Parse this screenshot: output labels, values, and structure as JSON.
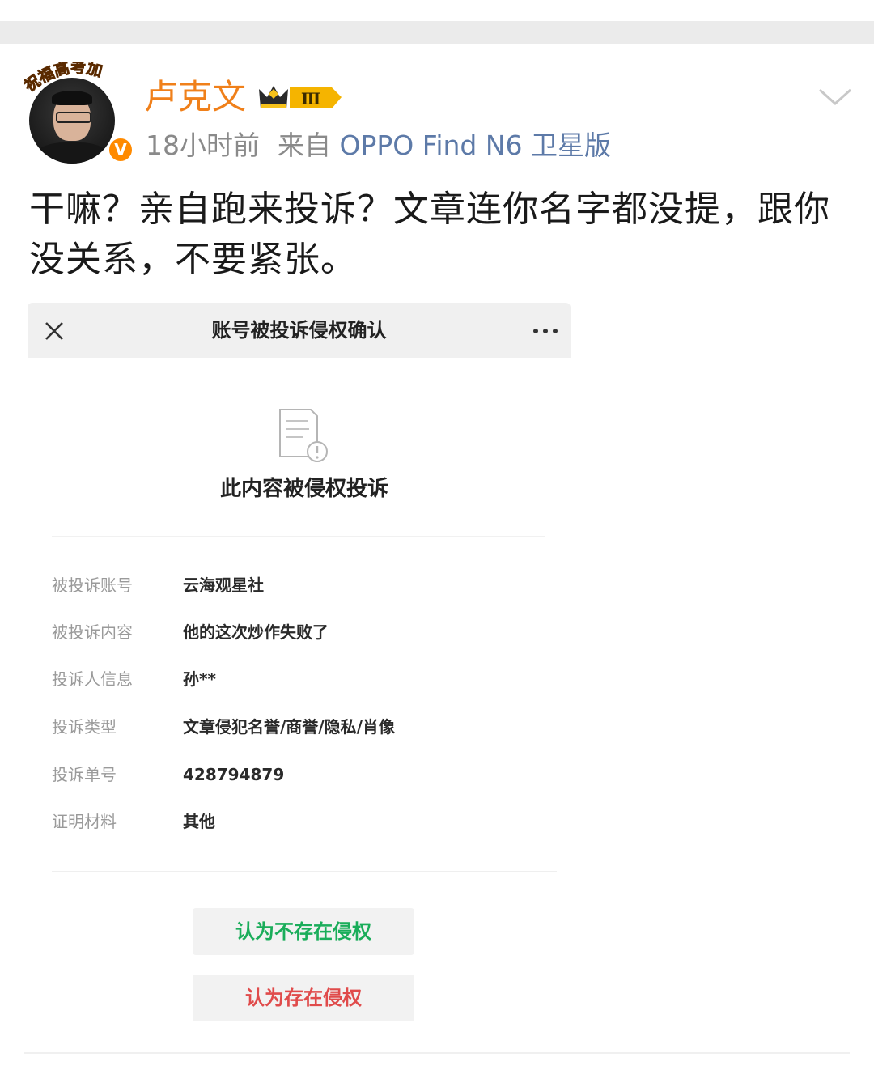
{
  "post": {
    "author": "卢克文",
    "avatar_badge_text": "祝福高考加",
    "verified_badge": "V",
    "vip_level": "Ⅲ",
    "time": "18小时前",
    "source_prefix": "来自",
    "device": "OPPO Find N6 卫星版",
    "text": "干嘛？亲自跑来投诉？文章连你名字都没提，跟你没关系，不要紧张。"
  },
  "screenshot": {
    "title": "账号被投诉侵权确认",
    "notice": "此内容被侵权投诉",
    "rows": [
      {
        "label": "被投诉账号",
        "value": "云海观星社"
      },
      {
        "label": "被投诉内容",
        "value": "他的这次炒作失败了"
      },
      {
        "label": "投诉人信息",
        "value": "孙**"
      },
      {
        "label": "投诉类型",
        "value": "文章侵犯名誉/商誉/隐私/肖像"
      },
      {
        "label": "投诉单号",
        "value": "428794879"
      },
      {
        "label": "证明材料",
        "value": "其他"
      }
    ],
    "button_no_infringement": "认为不存在侵权",
    "button_infringement": "认为存在侵权"
  },
  "colors": {
    "author": "#f0801a",
    "device_link": "#5d7aa8",
    "green_button": "#1aad5a",
    "red_button": "#e04b4b"
  },
  "icons": [
    "close-icon",
    "more-icon",
    "document-warning-icon",
    "chevron-down-icon",
    "crown-icon",
    "verified-icon"
  ]
}
